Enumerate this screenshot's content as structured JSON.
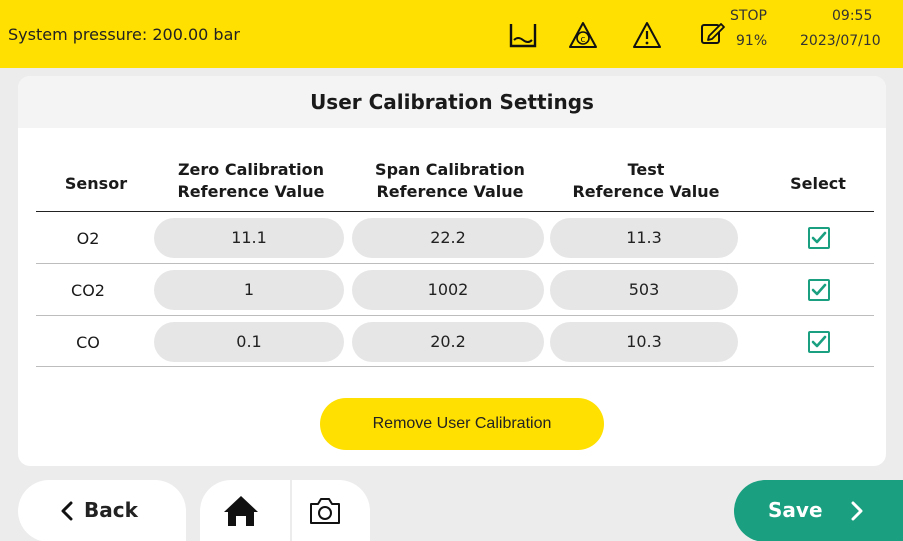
{
  "status_bar": {
    "pressure_text": "System pressure: 200.00 bar",
    "stop_label": "STOP",
    "stop_percent": "91%",
    "time": "09:55",
    "date": "2023/07/10",
    "icons": [
      "tank-icon",
      "calibration-c-icon",
      "warning-icon",
      "edit-icon"
    ]
  },
  "page": {
    "title": "User Calibration Settings"
  },
  "table": {
    "headers": {
      "sensor": "Sensor",
      "zero_line1": "Zero Calibration",
      "zero_line2": "Reference Value",
      "span_line1": "Span Calibration",
      "span_line2": "Reference Value",
      "test_line1": "Test",
      "test_line2": "Reference Value",
      "select": "Select"
    },
    "rows": [
      {
        "sensor": "O2",
        "zero": "11.1",
        "span": "22.2",
        "test": "11.3",
        "selected": true
      },
      {
        "sensor": "CO2",
        "zero": "1",
        "span": "1002",
        "test": "503",
        "selected": true
      },
      {
        "sensor": "CO",
        "zero": "0.1",
        "span": "20.2",
        "test": "10.3",
        "selected": true
      }
    ]
  },
  "actions": {
    "remove_label": "Remove  User Calibration",
    "back_label": "Back",
    "save_label": "Save"
  },
  "colors": {
    "accent_yellow": "#ffe000",
    "accent_green": "#1aa080",
    "background": "#ececec"
  }
}
